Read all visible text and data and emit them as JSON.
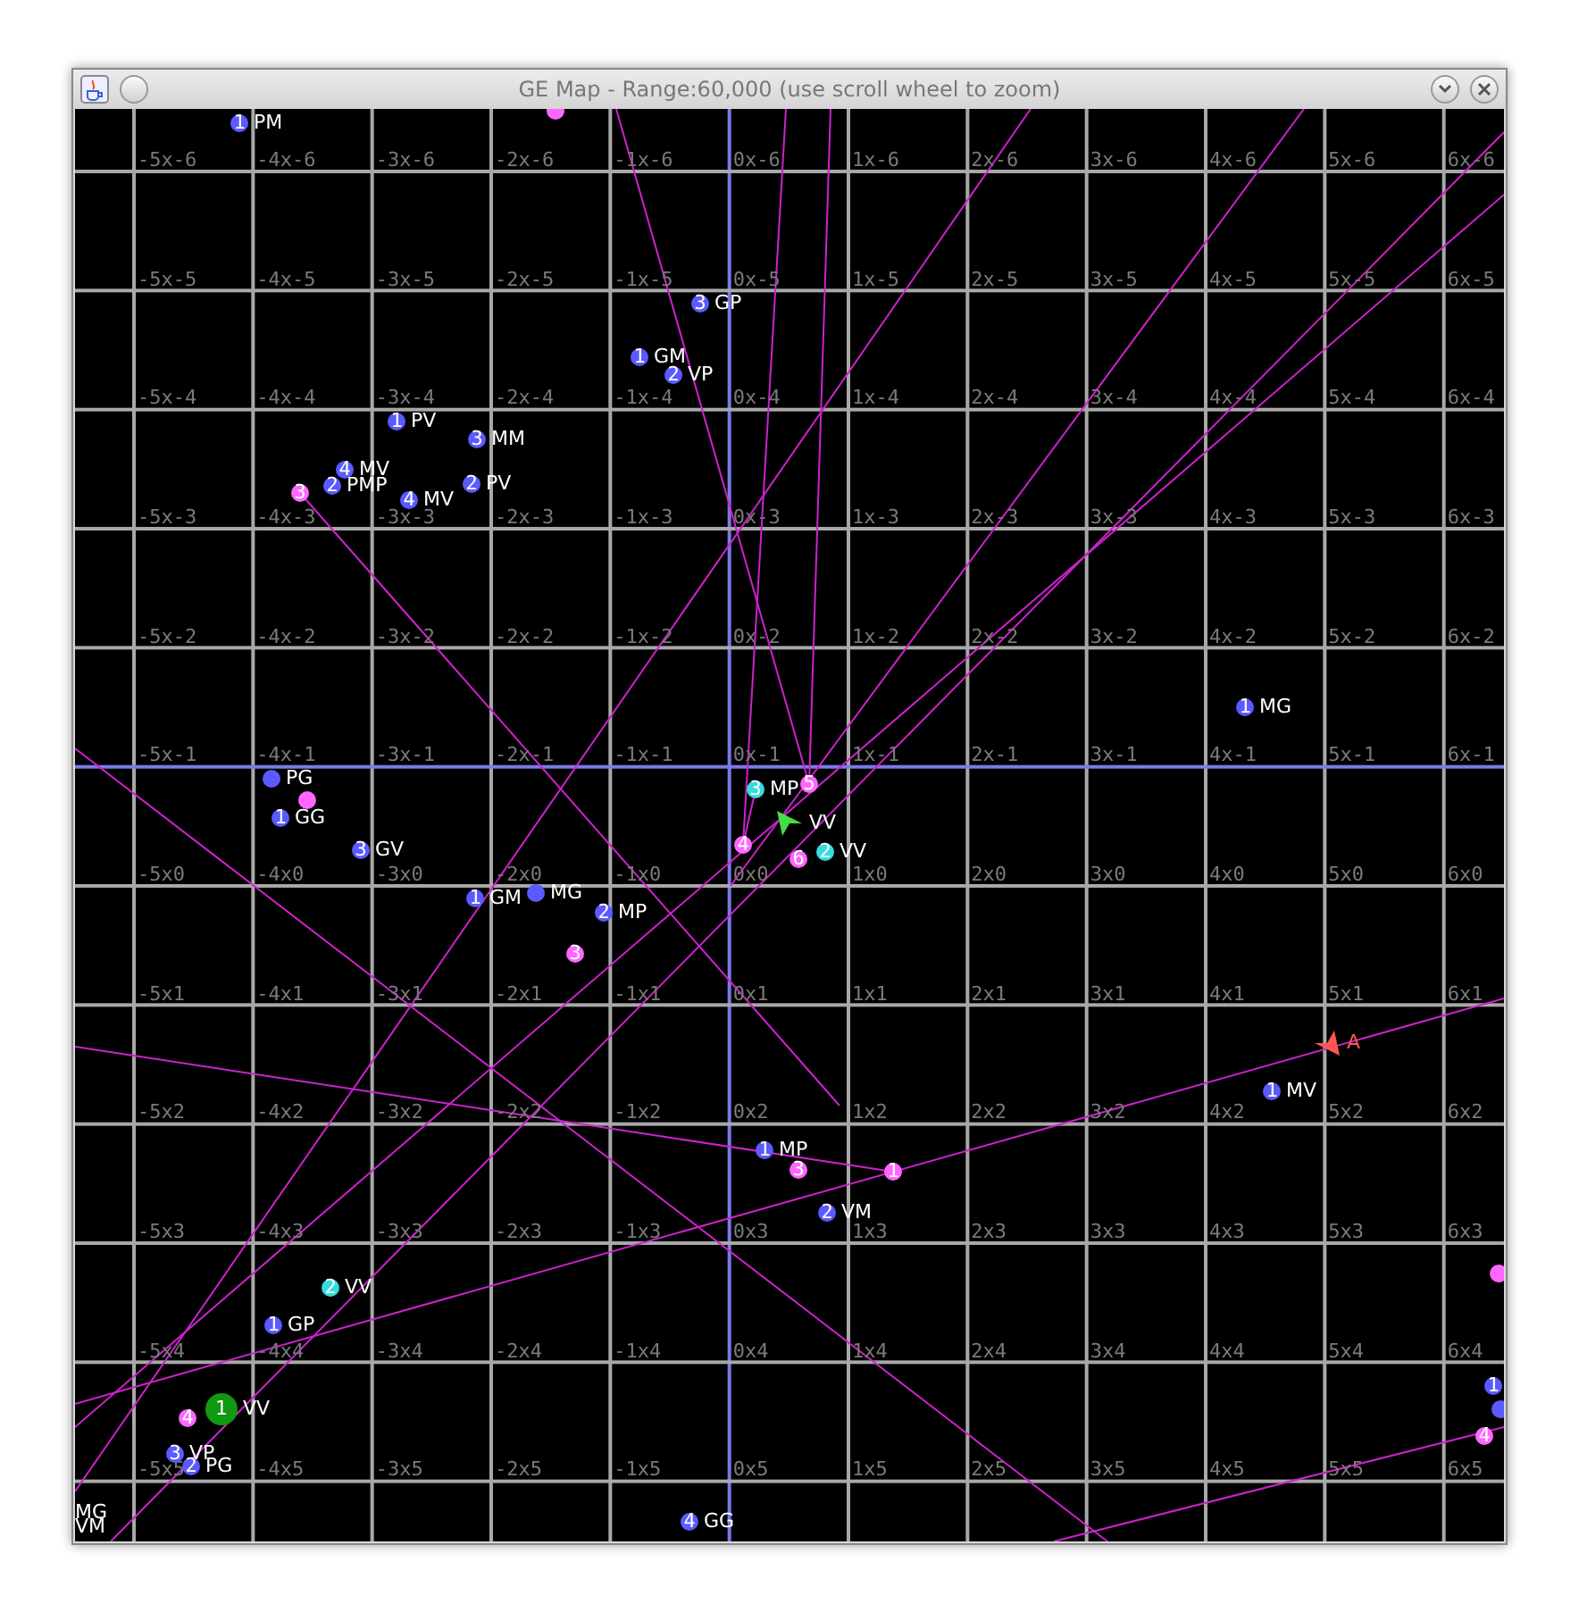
{
  "window": {
    "title": "GE Map - Range:60,000 (use scroll wheel to zoom)"
  },
  "map": {
    "grid": {
      "columns": [
        {
          "axis": false
        },
        {
          "axis": false
        },
        {
          "axis": false
        },
        {
          "axis": false
        },
        {
          "axis": false
        },
        {
          "axis": true
        },
        {
          "axis": false
        },
        {
          "axis": false
        },
        {
          "axis": false
        },
        {
          "axis": false
        },
        {
          "axis": false
        },
        {
          "axis": false
        }
      ],
      "rows": [
        {
          "axis": false,
          "labels": [
            "-5x-6",
            "-4x-6",
            "-3x-6",
            "-2x-6",
            "-1x-6",
            "0x-6",
            "1x-6",
            "2x-6",
            "3x-6",
            "4x-6",
            "5x-6",
            "6x-6"
          ]
        },
        {
          "axis": false,
          "labels": [
            "-5x-5",
            "-4x-5",
            "-3x-5",
            "-2x-5",
            "-1x-5",
            "0x-5",
            "1x-5",
            "2x-5",
            "3x-5",
            "4x-5",
            "5x-5",
            "6x-5"
          ]
        },
        {
          "axis": false,
          "labels": [
            "-5x-4",
            "-4x-4",
            "-3x-4",
            "-2x-4",
            "-1x-4",
            "0x-4",
            "1x-4",
            "2x-4",
            "3x-4",
            "4x-4",
            "5x-4",
            "6x-4"
          ]
        },
        {
          "axis": false,
          "labels": [
            "-5x-3",
            "-4x-3",
            "-3x-3",
            "-2x-3",
            "-1x-3",
            "0x-3",
            "1x-3",
            "2x-3",
            "3x-3",
            "4x-3",
            "5x-3",
            "6x-3"
          ]
        },
        {
          "axis": false,
          "labels": [
            "-5x-2",
            "-4x-2",
            "-3x-2",
            "-2x-2",
            "-1x-2",
            "0x-2",
            "1x-2",
            "2x-2",
            "3x-2",
            "4x-2",
            "5x-2",
            "6x-2"
          ]
        },
        {
          "axis": true,
          "labels": [
            "-5x-1",
            "-4x-1",
            "-3x-1",
            "-2x-1",
            "-1x-1",
            "0x-1",
            "1x-1",
            "2x-1",
            "3x-1",
            "4x-1",
            "5x-1",
            "6x-1"
          ]
        },
        {
          "axis": false,
          "labels": [
            "-5x0",
            "-4x0",
            "-3x0",
            "-2x0",
            "-1x0",
            "0x0",
            "1x0",
            "2x0",
            "3x0",
            "4x0",
            "5x0",
            "6x0"
          ]
        },
        {
          "axis": false,
          "labels": [
            "-5x1",
            "-4x1",
            "-3x1",
            "-2x1",
            "-1x1",
            "0x1",
            "1x1",
            "2x1",
            "3x1",
            "4x1",
            "5x1",
            "6x1"
          ]
        },
        {
          "axis": false,
          "labels": [
            "-5x2",
            "-4x2",
            "-3x2",
            "-2x2",
            "-1x2",
            "0x2",
            "1x2",
            "2x2",
            "3x2",
            "4x2",
            "5x2",
            "6x2"
          ]
        },
        {
          "axis": false,
          "labels": [
            "-5x3",
            "-4x3",
            "-3x3",
            "-2x3",
            "-1x3",
            "0x3",
            "1x3",
            "2x3",
            "3x3",
            "4x3",
            "5x3",
            "6x3"
          ]
        },
        {
          "axis": false,
          "labels": [
            "-5x4",
            "-4x4",
            "-3x4",
            "-2x4",
            "-1x4",
            "0x4",
            "1x4",
            "2x4",
            "3x4",
            "4x4",
            "5x4",
            "6x4"
          ]
        },
        {
          "axis": false,
          "labels": [
            "-5x5",
            "-4x5",
            "-3x5",
            "-2x5",
            "-1x5",
            "0x5",
            "1x5",
            "2x5",
            "3x5",
            "4x5",
            "5x5",
            "6x5"
          ]
        }
      ]
    },
    "units": [
      {
        "kind": "dot",
        "number": "1",
        "label": "PM",
        "color": "#5a5aff"
      },
      {
        "kind": "dot",
        "color": "#ff66ff"
      },
      {
        "kind": "dot",
        "number": "3",
        "label": "GP",
        "color": "#5a5aff"
      },
      {
        "kind": "dot",
        "number": "1",
        "label": "GM",
        "color": "#5a5aff"
      },
      {
        "kind": "dot",
        "number": "2",
        "label": "VP",
        "color": "#5a5aff"
      },
      {
        "kind": "dot",
        "number": "1",
        "label": "PV",
        "color": "#5a5aff"
      },
      {
        "kind": "dot",
        "number": "3",
        "label": "MM",
        "color": "#5a5aff"
      },
      {
        "kind": "dot",
        "number": "4",
        "label": "MV",
        "color": "#5a5aff"
      },
      {
        "kind": "dot",
        "number": "2",
        "label": "PMP",
        "color": "#5a5aff"
      },
      {
        "kind": "dot",
        "number": "3",
        "color": "#ff66ff"
      },
      {
        "kind": "dot",
        "number": "4",
        "label": "MV",
        "color": "#5a5aff"
      },
      {
        "kind": "dot",
        "number": "2",
        "label": "PV",
        "color": "#5a5aff"
      },
      {
        "kind": "dot",
        "label": "PG",
        "color": "#5a5aff"
      },
      {
        "kind": "dot",
        "number": "1",
        "label": "GG",
        "color": "#5a5aff"
      },
      {
        "kind": "dot",
        "color": "#ff66ff"
      },
      {
        "kind": "dot",
        "number": "3",
        "label": "GV",
        "color": "#5a5aff"
      },
      {
        "kind": "dot",
        "number": "1",
        "label": "GM",
        "color": "#5a5aff"
      },
      {
        "kind": "dot",
        "label": "MG",
        "color": "#5a5aff"
      },
      {
        "kind": "dot",
        "number": "2",
        "label": "MP",
        "color": "#5a5aff"
      },
      {
        "kind": "dot",
        "number": "3",
        "color": "#ff66ff"
      },
      {
        "kind": "dot",
        "number": "3",
        "label": "MP",
        "color": "#33dddd"
      },
      {
        "kind": "dot",
        "number": "5",
        "color": "#ff66ff"
      },
      {
        "kind": "dot",
        "number": "4",
        "color": "#ff66ff"
      },
      {
        "kind": "dot",
        "number": "6",
        "color": "#ff66ff"
      },
      {
        "kind": "arrow",
        "label": "VV",
        "color": "#44dd44"
      },
      {
        "kind": "dot",
        "number": "2",
        "label": "VV",
        "color": "#33dddd"
      },
      {
        "kind": "dot",
        "number": "1",
        "label": "MG",
        "color": "#5a5aff"
      },
      {
        "kind": "arrow",
        "label": "A",
        "color": "#ff5555"
      },
      {
        "kind": "dot",
        "number": "1",
        "label": "MV",
        "color": "#5a5aff"
      },
      {
        "kind": "dot",
        "number": "1",
        "label": "MP",
        "color": "#5a5aff"
      },
      {
        "kind": "dot",
        "number": "3",
        "color": "#ff66ff"
      },
      {
        "kind": "dot",
        "number": "1",
        "color": "#ff66ff"
      },
      {
        "kind": "dot",
        "number": "2",
        "label": "VM",
        "color": "#5a5aff"
      },
      {
        "kind": "dot",
        "number": "2",
        "label": "VV",
        "color": "#33dddd"
      },
      {
        "kind": "dot",
        "number": "1",
        "label": "GP",
        "color": "#5a5aff"
      },
      {
        "kind": "dot",
        "number": "4",
        "color": "#ff66ff"
      },
      {
        "kind": "big",
        "number": "1",
        "label": "VV",
        "color": "#119911"
      },
      {
        "kind": "dot",
        "number": "3",
        "label": "VP",
        "color": "#5a5aff"
      },
      {
        "kind": "dot",
        "number": "2",
        "label": "PG",
        "color": "#5a5aff"
      },
      {
        "kind": "dot",
        "number": "4",
        "label": "GG",
        "color": "#5a5aff"
      },
      {
        "kind": "dot",
        "color": "#ff66ff"
      },
      {
        "kind": "dot",
        "number": "1",
        "color": "#5a5aff"
      },
      {
        "kind": "dot",
        "color": "#5a5aff"
      },
      {
        "kind": "dot",
        "number": "4",
        "color": "#ff66ff"
      }
    ],
    "corner_labels": [
      "MG",
      "VM"
    ]
  }
}
